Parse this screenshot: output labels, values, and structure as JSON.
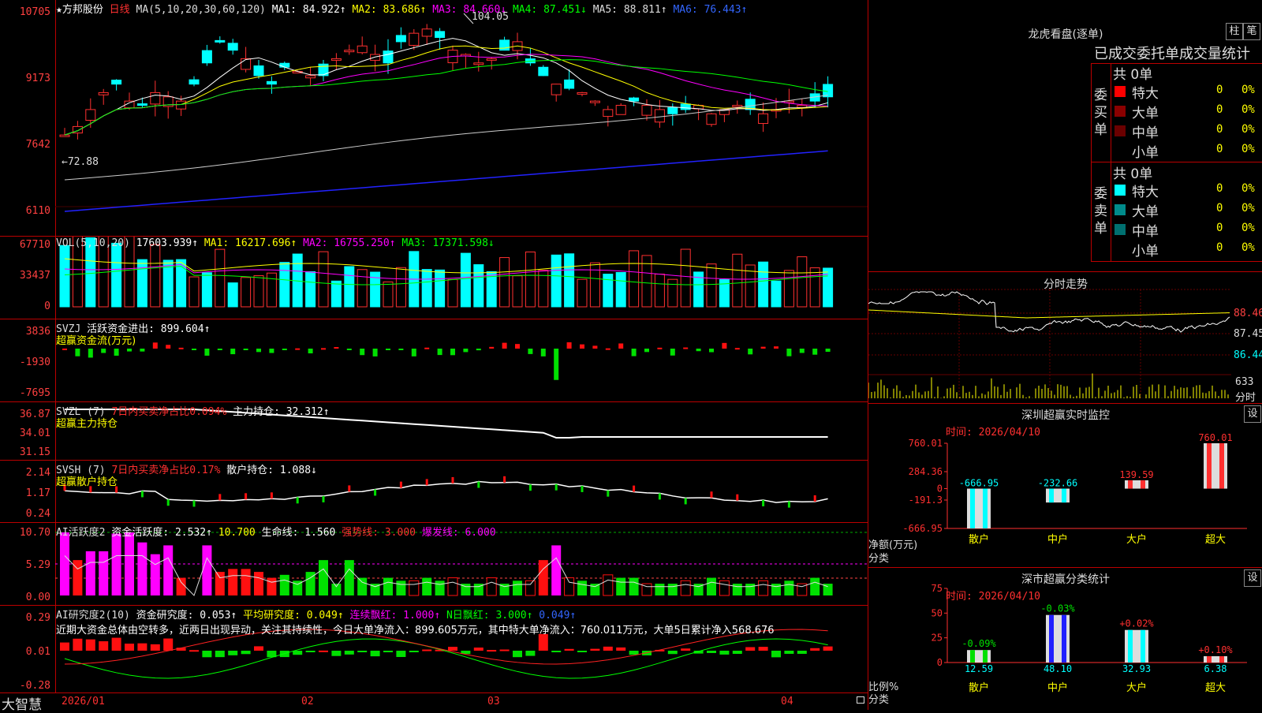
{
  "main": {
    "stock_name": "★方邦股份",
    "period": "日线",
    "ma_label": "MA(5,10,20,30,60,120)",
    "ma1": "MA1: 84.922↑",
    "ma2": "MA2: 83.686↑",
    "ma3": "MA3: 84.660↓",
    "ma4": "MA4: 87.451↓",
    "ma5": "MA5: 88.811↑",
    "ma6": "MA6: 76.443↑",
    "ticks": [
      "10705",
      "9173",
      "7642",
      "6110"
    ],
    "high_marker": "104.05",
    "low_marker": "←72.88"
  },
  "vol": {
    "label": "VOL(5,10,20)",
    "value": "17603.939↑",
    "ma1": "MA1: 16217.696↑",
    "ma2": "MA2: 16755.250↑",
    "ma3": "MA3: 17371.598↓",
    "ticks": [
      "67710",
      "33437",
      "0"
    ]
  },
  "svzj": {
    "label": "SVZJ",
    "line1": "活跃资金进出: 899.604↑",
    "line2": "超赢资金流(万元)",
    "ticks": [
      "3836",
      "-1930",
      "-7695"
    ]
  },
  "svzl": {
    "label": "SVZL (7)",
    "pct": "7日内买卖净占比0.094%",
    "hold": "主力持仓: 32.312↑",
    "line2": "超赢主力持仓",
    "ticks": [
      "36.87",
      "34.01",
      "31.15"
    ]
  },
  "svsh": {
    "label": "SVSH (7)",
    "pct": "7日内买卖净占比0.17%",
    "hold": "散户持仓: 1.088↓",
    "line2": "超赢散户持仓",
    "ticks": [
      "2.14",
      "1.17",
      "0.24"
    ]
  },
  "ai1": {
    "label": "AI活跃度2",
    "v1": "资金活跃度: 2.532↑",
    "v2": "10.700",
    "v3": "生命线: 1.560",
    "v4": "强势线: 3.000",
    "v5": "爆发线: 6.000",
    "ticks": [
      "10.70",
      "5.29",
      "0.00"
    ]
  },
  "ai2": {
    "label": "AI研究度2(10)",
    "v1": "资金研究度: 0.053↑",
    "v2": "平均研究度: 0.049↑",
    "v3": "连续飘红: 1.000↑",
    "v4": "N日飘红: 3.000↑",
    "v5": "0.049↑",
    "comment": "近期大资金总体由空转多，近两日出现异动，关注其持续性，今日大单净流入：899.605万元，其中特大单净流入：760.011万元，大单5日累计净入568.676",
    "ticks": [
      "0.29",
      "0.01",
      "-0.28"
    ]
  },
  "bottom": {
    "brand": "大智慧",
    "dates": [
      "2026/01",
      "02",
      "03",
      "04"
    ]
  },
  "dragon": {
    "title": "龙虎看盘(逐单)",
    "btn1": "柱",
    "btn2": "笔",
    "subtitle": "已成交委托单成交量统计",
    "buy_label": "委买单",
    "sell_label": "委卖单",
    "buy_total": "共 0单",
    "sell_total": "共 0单",
    "buy_rows": [
      {
        "name": "特大",
        "count": "0",
        "pct": "0%",
        "color": "#ff0000"
      },
      {
        "name": "大单",
        "count": "0",
        "pct": "0%",
        "color": "#8b0000"
      },
      {
        "name": "中单",
        "count": "0",
        "pct": "0%",
        "color": "#6b0000"
      },
      {
        "name": "小单",
        "count": "0",
        "pct": "0%",
        "color": "#000000"
      }
    ],
    "sell_rows": [
      {
        "name": "特大",
        "count": "0",
        "pct": "0%",
        "color": "#00ffff"
      },
      {
        "name": "大单",
        "count": "0",
        "pct": "0%",
        "color": "#008b8b"
      },
      {
        "name": "中单",
        "count": "0",
        "pct": "0%",
        "color": "#007070"
      },
      {
        "name": "小单",
        "count": "0",
        "pct": "0%",
        "color": "#000000"
      }
    ]
  },
  "intraday": {
    "title": "分时走势",
    "ticks": [
      "88.46",
      "87.45",
      "86.44"
    ],
    "vol_tick": "633",
    "vol_label": "分时"
  },
  "sz_monitor": {
    "title": "深圳超赢实时监控",
    "set_btn": "设",
    "time": "时间: 2026/04/10",
    "ticks": [
      "760.01",
      "284.36",
      "0",
      "-191.3",
      "-666.95"
    ],
    "ylabel": "净额(万元)",
    "xlabel": "分类",
    "categories": [
      "散户",
      "中户",
      "大户",
      "超大"
    ],
    "values": [
      -666.95,
      -232.66,
      139.59,
      760.01
    ],
    "value_labels": [
      "-666.95",
      "-232.66",
      "139.59",
      "760.01"
    ]
  },
  "sz_stats": {
    "title": "深市超赢分类统计",
    "set_btn": "设",
    "time": "时间: 2026/04/10",
    "ticks": [
      "75",
      "50",
      "25",
      "0"
    ],
    "ylabel": "比例%",
    "xlabel": "分类",
    "categories": [
      "散户",
      "中户",
      "大户",
      "超大"
    ],
    "values": [
      12.59,
      48.1,
      32.93,
      6.38
    ],
    "value_labels": [
      "12.59",
      "48.10",
      "32.93",
      "6.38"
    ],
    "changes": [
      "-0.09%",
      "-0.03%",
      "+0.02%",
      "+0.10%"
    ]
  }
}
